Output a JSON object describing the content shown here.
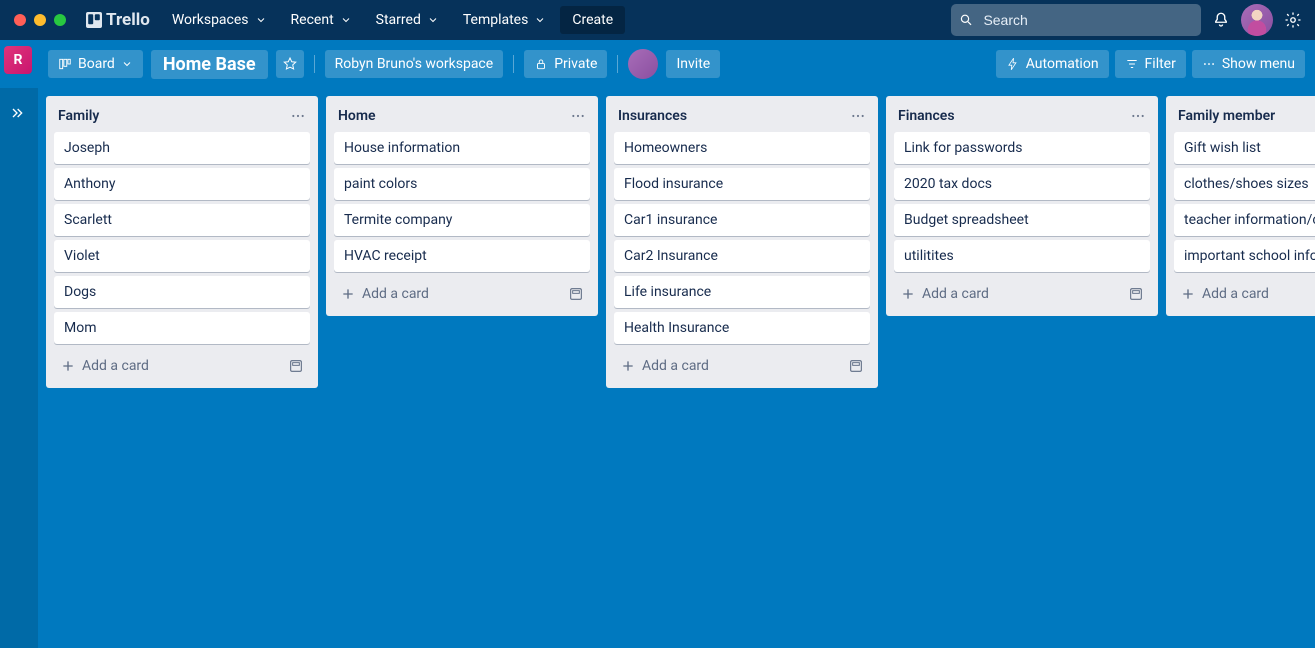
{
  "header": {
    "logo_text": "Trello",
    "nav": {
      "workspaces": "Workspaces",
      "recent": "Recent",
      "starred": "Starred",
      "templates": "Templates",
      "create": "Create"
    },
    "search_placeholder": "Search"
  },
  "board_bar": {
    "workspace_initial": "R",
    "view_label": "Board",
    "board_name": "Home Base",
    "workspace_name": "Robyn Bruno's workspace",
    "visibility": "Private",
    "invite": "Invite",
    "automation": "Automation",
    "filter": "Filter",
    "show_menu": "Show menu"
  },
  "footer": {
    "add_card": "Add a card"
  },
  "lists": [
    {
      "title": "Family",
      "cards": [
        "Joseph",
        "Anthony",
        "Scarlett",
        "Violet",
        "Dogs",
        "Mom"
      ]
    },
    {
      "title": "Home",
      "cards": [
        "House information",
        "paint colors",
        "Termite company",
        "HVAC receipt"
      ]
    },
    {
      "title": "Insurances",
      "cards": [
        "Homeowners",
        "Flood insurance",
        "Car1 insurance",
        "Car2 Insurance",
        "Life insurance",
        "Health Insurance"
      ]
    },
    {
      "title": "Finances",
      "cards": [
        "Link for passwords",
        "2020 tax docs",
        "Budget spreadsheet",
        "utilitites"
      ]
    },
    {
      "title": "Family member",
      "cards": [
        "Gift wish list",
        "clothes/shoes sizes",
        "teacher information/contacts",
        "important school info"
      ]
    }
  ]
}
